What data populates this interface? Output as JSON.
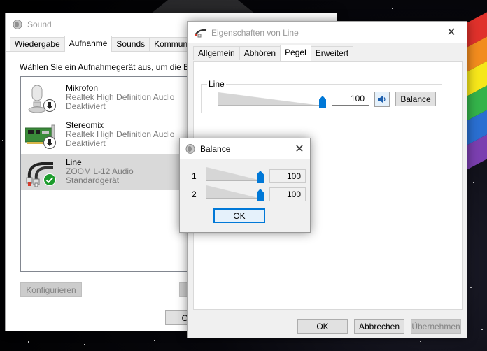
{
  "sound_window": {
    "title": "Sound",
    "tabs": [
      "Wiedergabe",
      "Aufnahme",
      "Sounds",
      "Kommunikation"
    ],
    "active_tab": 1,
    "instruction": "Wählen Sie ein Aufnahmegerät aus, um die Ein",
    "devices": [
      {
        "name": "Mikrofon",
        "driver": "Realtek High Definition Audio",
        "status": "Deaktiviert",
        "icon": "microphone-icon",
        "badge": "down-arrow-icon"
      },
      {
        "name": "Stereomix",
        "driver": "Realtek High Definition Audio",
        "status": "Deaktiviert",
        "icon": "sound-card-icon",
        "badge": "down-arrow-icon"
      },
      {
        "name": "Line",
        "driver": "ZOOM L-12 Audio",
        "status": "Standardgerät",
        "icon": "rca-cable-icon",
        "badge": "checkmark-icon"
      }
    ],
    "configure_button": "Konfigurieren",
    "properties_button_partial": "Ei",
    "ok_button_partial": "O"
  },
  "properties_window": {
    "title": "Eigenschaften von Line",
    "tabs": [
      "Allgemein",
      "Abhören",
      "Pegel",
      "Erweitert"
    ],
    "active_tab": 2,
    "group_label": "Line",
    "level_value": "100",
    "level_fraction": 1.0,
    "balance_button": "Balance",
    "ok_button": "OK",
    "cancel_button": "Abbrechen",
    "apply_button": "Übernehmen"
  },
  "balance_dialog": {
    "title": "Balance",
    "channels": [
      {
        "label": "1",
        "value": "100",
        "fraction": 1.0
      },
      {
        "label": "2",
        "value": "100",
        "fraction": 1.0
      }
    ],
    "ok_button": "OK"
  },
  "colors": {
    "accent": "#0078d7",
    "selection": "#d9d9d9",
    "badge_green": "#1e9c2e"
  }
}
